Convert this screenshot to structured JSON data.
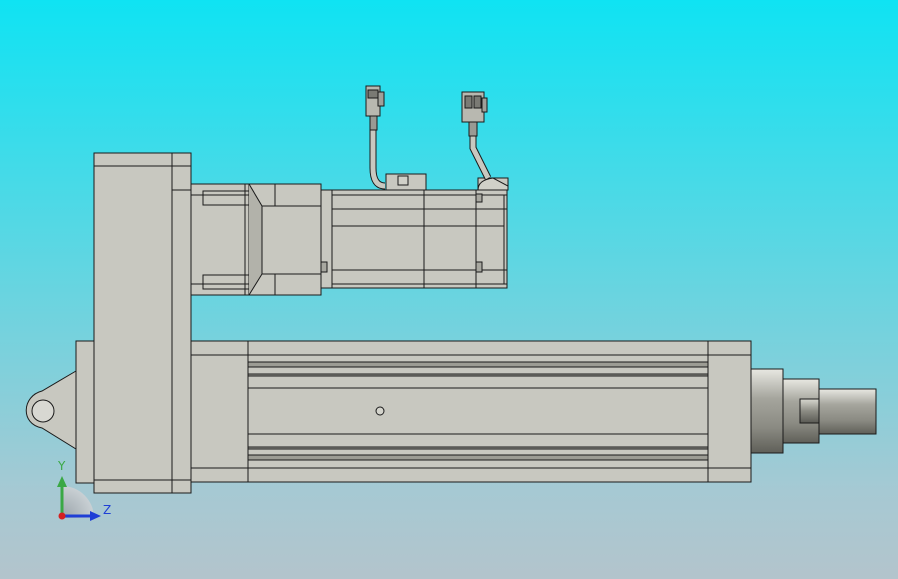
{
  "viewport": {
    "background_top": "#0fe3f3",
    "background_bottom": "#b3c4cc",
    "part_color": "#c8c8c0",
    "edge_color": "#1a1a1a"
  },
  "triad": {
    "y_label": "Y",
    "z_label": "Z",
    "y_color": "#3aa845",
    "z_color": "#1f3fd6",
    "x_color": "#d42020"
  }
}
